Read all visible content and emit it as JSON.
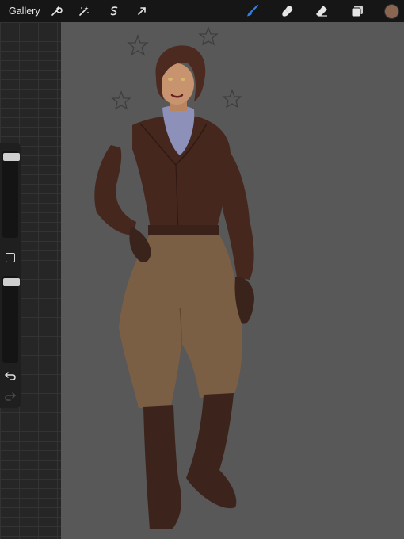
{
  "toolbar": {
    "gallery_label": "Gallery",
    "left_tools": [
      "wrench-icon",
      "magic-wand-icon",
      "selection-icon",
      "transform-arrow-icon"
    ],
    "right_tools": [
      "brush-icon",
      "smudge-icon",
      "eraser-icon",
      "layers-icon",
      "color-swatch"
    ],
    "active_tool": "brush",
    "accent_color": "#2f7fe6",
    "current_color": "#8a6650"
  },
  "sidebar": {
    "brush_size_level": 0.03,
    "opacity_level": 0.03,
    "undo_icon": "undo-arrow-icon",
    "redo_icon": "redo-arrow-icon"
  },
  "canvas": {
    "background_color": "#585858"
  }
}
